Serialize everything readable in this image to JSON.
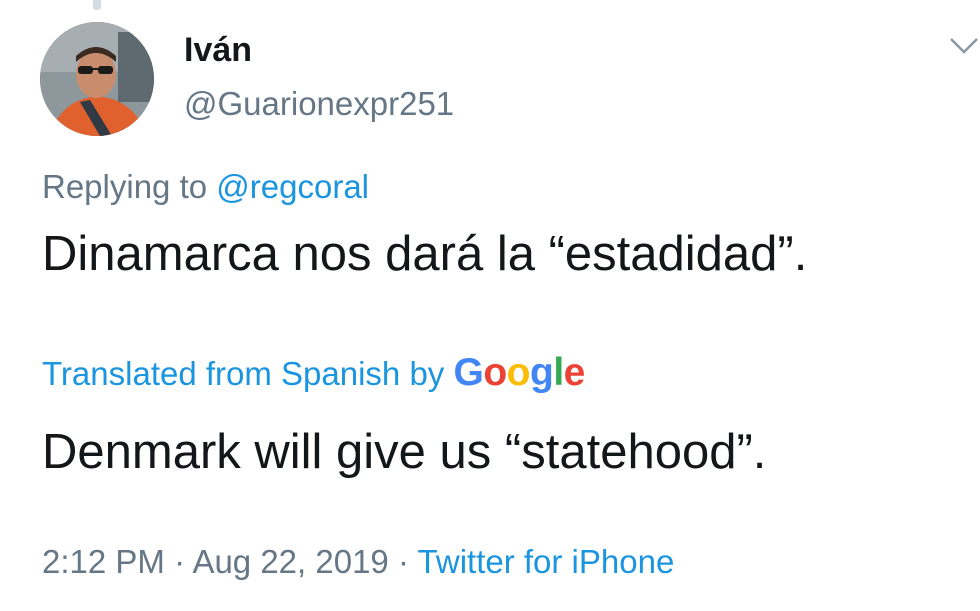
{
  "tweet": {
    "author": {
      "display_name": "Iván",
      "handle": "@Guarionexpr251"
    },
    "reply": {
      "prefix": "Replying to",
      "mention": "@regcoral"
    },
    "text": "Dinamarca nos dará la “estadidad”.",
    "translation": {
      "label": "Translated from Spanish by",
      "provider": "Google",
      "text": "Denmark will give us “statehood”."
    },
    "meta": {
      "time": "2:12 PM",
      "date": "Aug 22, 2019",
      "source": "Twitter for iPhone",
      "separator": "·"
    }
  },
  "icons": {
    "menu": "chevron-down-icon"
  },
  "colors": {
    "text_primary": "#14171a",
    "text_secondary": "#657786",
    "link": "#1b95e0",
    "google_blue": "#4285f4",
    "google_red": "#ea4335",
    "google_yellow": "#fbbc05",
    "google_green": "#34a853"
  }
}
